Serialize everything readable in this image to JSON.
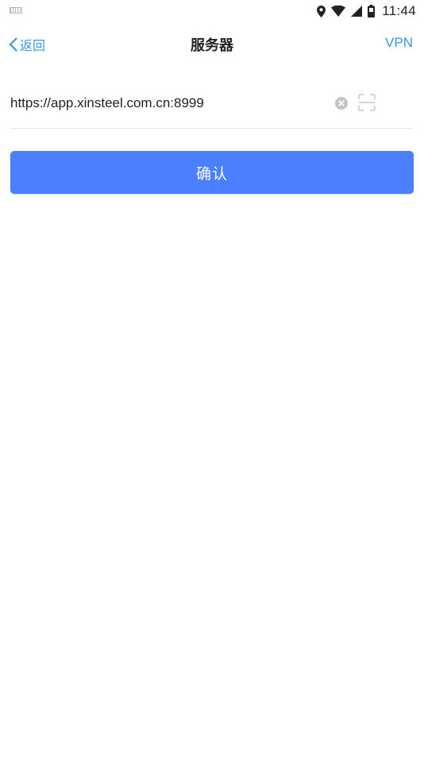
{
  "status_bar": {
    "time": "11:44",
    "icons": [
      "keyboard-icon",
      "location-icon",
      "wifi-icon",
      "signal-icon",
      "battery-icon"
    ]
  },
  "nav": {
    "back_label": "返回",
    "title": "服务器",
    "vpn_label": "VPN"
  },
  "server_form": {
    "server_url_value": "https://app.xinsteel.com.cn:8999",
    "clear_icon": "clear-icon",
    "scan_icon": "scan-icon",
    "confirm_label": "确认"
  },
  "colors": {
    "accent": "#3a97e6",
    "button": "#4a7fff",
    "divider": "#e6e6e6"
  }
}
